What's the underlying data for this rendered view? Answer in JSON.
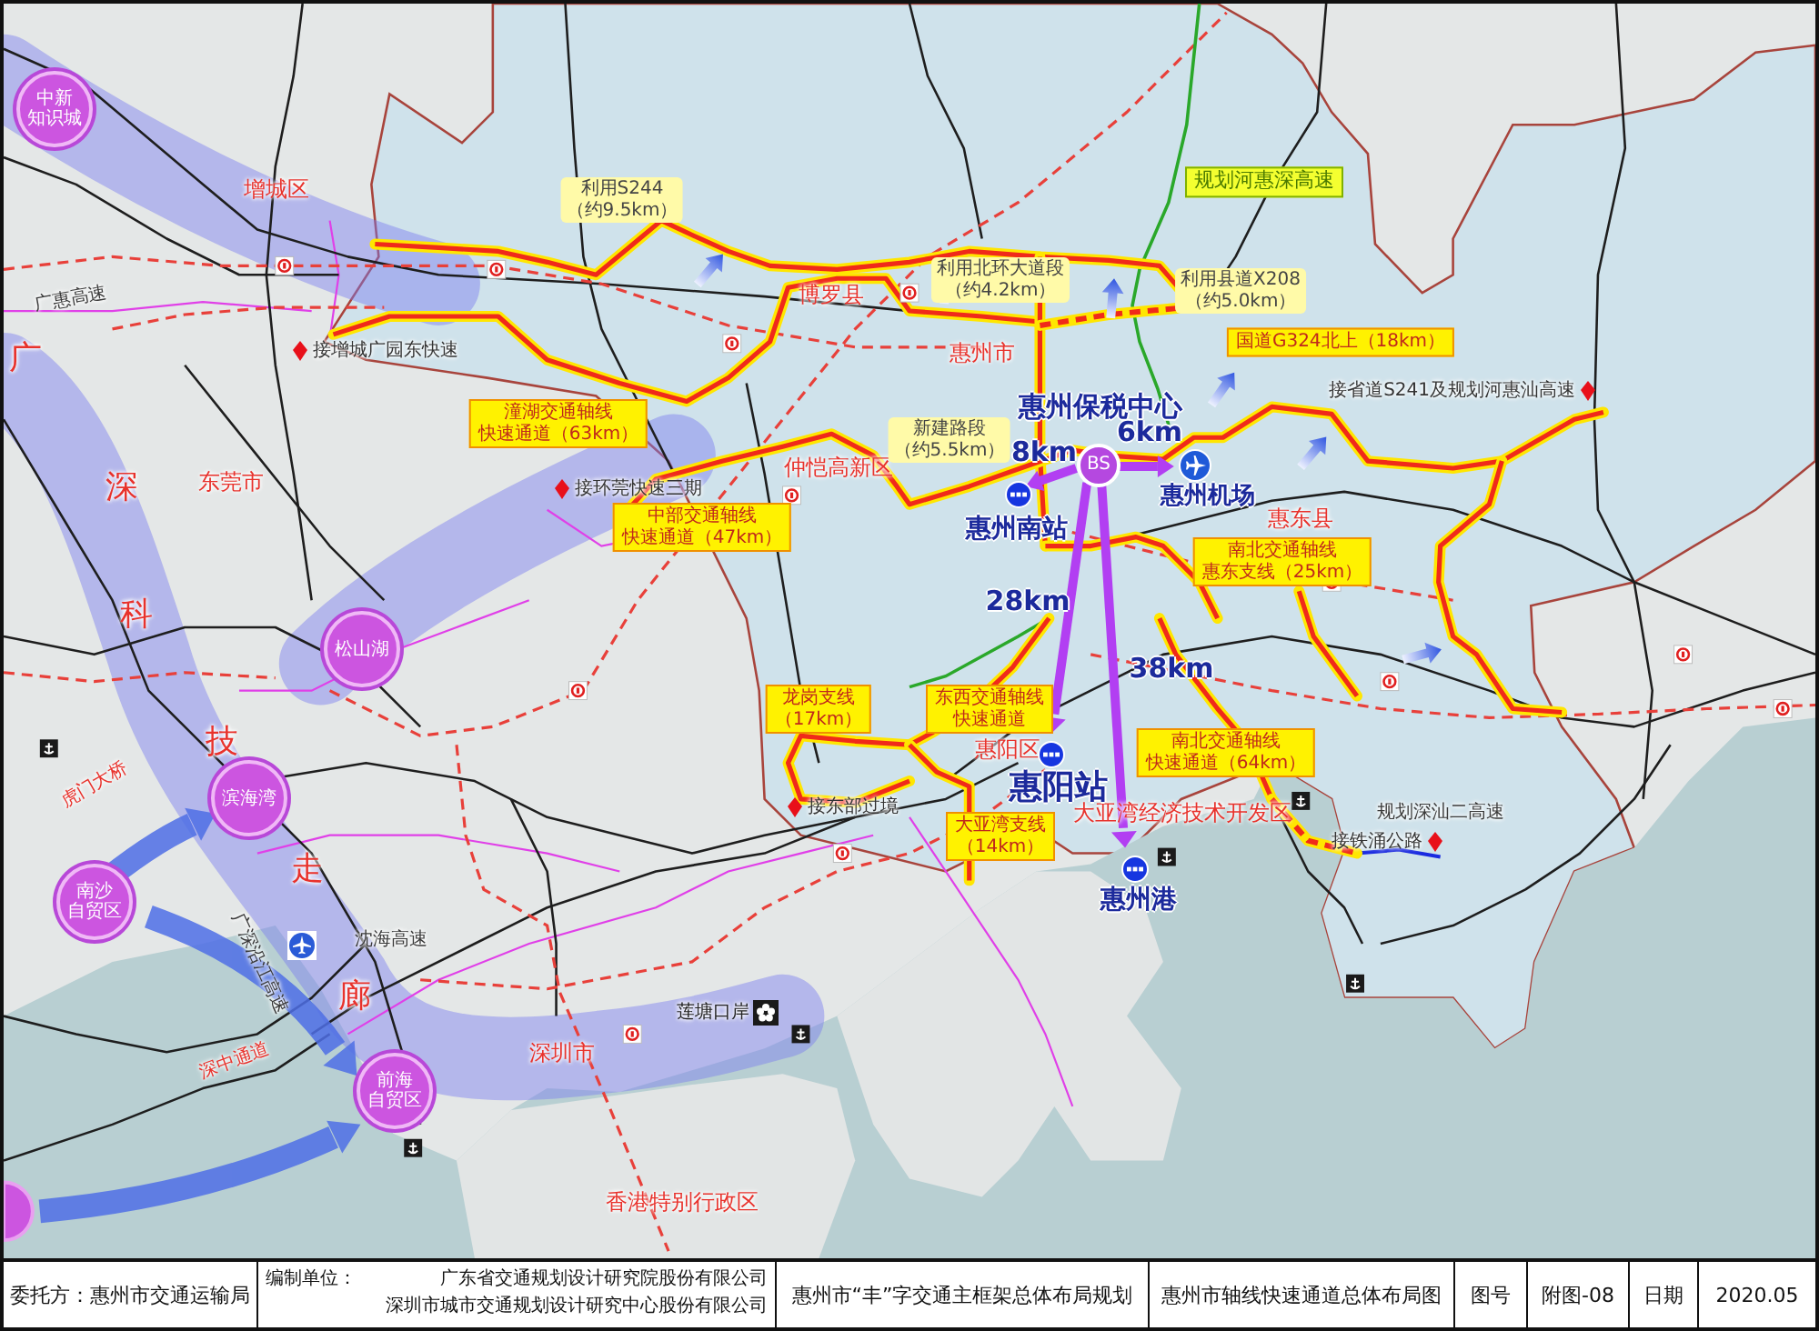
{
  "map": {
    "hubs": [
      {
        "lines": [
          "中新",
          "知识城"
        ]
      },
      {
        "lines": [
          "松山湖"
        ]
      },
      {
        "lines": [
          "滨海湾"
        ]
      },
      {
        "lines": [
          "南沙",
          "自贸区"
        ]
      },
      {
        "lines": [
          "前海",
          "自贸区"
        ]
      }
    ],
    "corridor_characters": [
      "广",
      "深",
      "科",
      "技",
      "走",
      "廊"
    ],
    "districts": [
      "增城区",
      "东莞市",
      "博罗县",
      "惠州市",
      "仲恺高新区",
      "惠东县",
      "惠阳区",
      "大亚湾经济技术开发区",
      "深圳市",
      "香港特别行政区"
    ],
    "callouts": [
      {
        "kind": "axis",
        "lines": [
          "潼湖交通轴线",
          "快速通道（63km）"
        ]
      },
      {
        "kind": "axis",
        "lines": [
          "中部交通轴线",
          "快速通道（47km）"
        ]
      },
      {
        "kind": "axis",
        "lines": [
          "南北交通轴线",
          "惠东支线（25km）"
        ]
      },
      {
        "kind": "axis",
        "lines": [
          "东西交通轴线",
          "快速通道"
        ]
      },
      {
        "kind": "axis",
        "lines": [
          "南北交通轴线",
          "快速通道（64km）"
        ]
      },
      {
        "kind": "axis",
        "lines": [
          "大亚湾支线",
          "（14km）"
        ]
      },
      {
        "kind": "axis",
        "lines": [
          "龙岗支线",
          "（17km）"
        ]
      },
      {
        "kind": "planned",
        "lines": [
          "规划河惠深高速"
        ]
      },
      {
        "kind": "axis",
        "lines": [
          "国道G324北上（18km）"
        ]
      },
      {
        "kind": "segment",
        "lines": [
          "利用S244",
          "（约9.5km）"
        ]
      },
      {
        "kind": "segment",
        "lines": [
          "利用北环大道段",
          "（约4.2km）"
        ]
      },
      {
        "kind": "segment",
        "lines": [
          "利用县道X208",
          "（约5.0km）"
        ]
      },
      {
        "kind": "segment",
        "lines": [
          "新建路段",
          "（约5.5km）"
        ]
      }
    ],
    "connections": [
      "接增城广园东快速",
      "接环莞快速三期",
      "接东部过境",
      "接省道S241及规划河惠汕高速",
      "接铁涌公路"
    ],
    "road_names": [
      {
        "kind": "highway",
        "text": "广惠高速"
      },
      {
        "kind": "crossing",
        "text": "虎门大桥"
      },
      {
        "kind": "highway",
        "text": "广深沿江高速"
      },
      {
        "kind": "highway",
        "text": "沈海高速"
      },
      {
        "kind": "crossing",
        "text": "深中通道"
      },
      {
        "kind": "highway",
        "text": "规划深汕二高速"
      }
    ],
    "checkpoint": {
      "name": "莲塘口岸"
    },
    "hub_center": {
      "badge": "BS",
      "name": "惠州保税中心"
    },
    "stations": [
      {
        "kind": "airport",
        "name": "惠州机场"
      },
      {
        "kind": "rail",
        "name": "惠州南站"
      },
      {
        "kind": "rail",
        "name": "惠阳站"
      },
      {
        "kind": "port",
        "name": "惠州港"
      }
    ],
    "distances": [
      "8km",
      "6km",
      "28km",
      "38km"
    ]
  },
  "title_block": {
    "client": "委托方：惠州市交通运输局",
    "designer_label": "编制单位：",
    "designers": [
      "广东省交通规划设计研究院股份有限公司",
      "深圳市城市交通规划设计研究中心股份有限公司"
    ],
    "project": "惠州市“丰”字交通主框架总体布局规划",
    "drawing_title": "惠州市轴线快速通道总体布局图",
    "figure_no_label": "图号",
    "figure_no": "附图-08",
    "date_label": "日期",
    "date": "2020.05"
  }
}
